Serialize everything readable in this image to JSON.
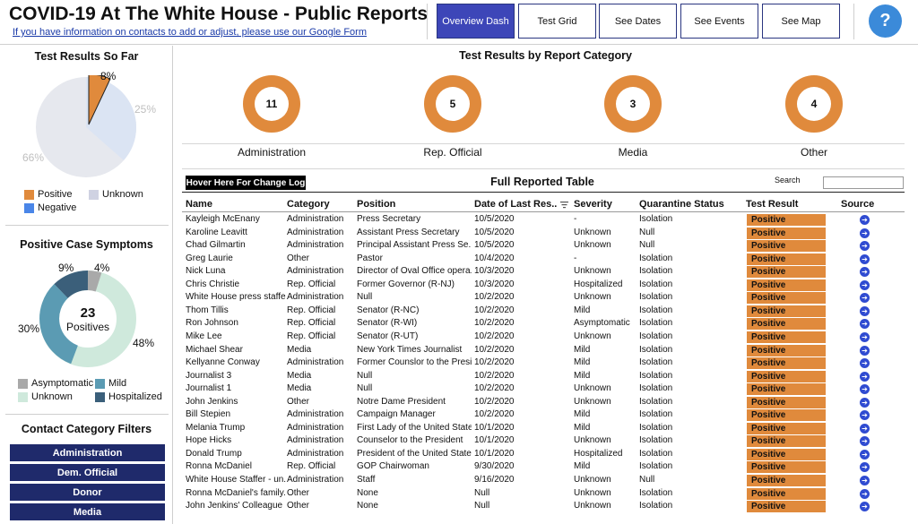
{
  "header": {
    "title": "COVID-19 At The White House - Public Reports",
    "form_link": "If you have information on contacts to add or adjust, please use our Google Form",
    "nav": [
      "Overview Dash",
      "Test Grid",
      "See Dates",
      "See Events",
      "See Map"
    ],
    "active_nav": "Overview Dash",
    "help_label": "?"
  },
  "test_results": {
    "title": "Test Results So Far",
    "labels": {
      "positive": "8%",
      "negative": "25%",
      "unknown": "66%"
    },
    "legend": {
      "positive": "Positive",
      "unknown": "Unknown",
      "negative": "Negative"
    },
    "colors": {
      "positive": "#e08a3c",
      "negative": "#dbe4f3",
      "unknown": "#e6e8ee"
    }
  },
  "symptoms": {
    "title": "Positive Case Symptoms",
    "center_value": "23",
    "center_label": "Positives",
    "labels": {
      "asymptomatic": "4%",
      "hospitalized": "9%",
      "mild": "30%",
      "unknown": "48%"
    },
    "legend": {
      "asymptomatic": "Asymptomatic",
      "mild": "Mild",
      "unknown": "Unknown",
      "hospitalized": "Hospitalized"
    },
    "colors": {
      "asymptomatic": "#a9a9a9",
      "mild": "#5b9bb3",
      "unknown": "#cfe9dc",
      "hospitalized": "#3b5f7a"
    }
  },
  "filters": {
    "title": "Contact Category Filters",
    "items": [
      "Administration",
      "Dem. Official",
      "Donor",
      "Media"
    ]
  },
  "categories": {
    "title": "Test Results by Report Category",
    "items": [
      {
        "count": "11",
        "label": "Administration"
      },
      {
        "count": "5",
        "label": "Rep. Official"
      },
      {
        "count": "3",
        "label": "Media"
      },
      {
        "count": "4",
        "label": "Other"
      }
    ]
  },
  "table": {
    "changelog": "Hover Here For Change Log",
    "title": "Full Reported Table",
    "search_label": "Search",
    "search_value": "",
    "columns": [
      "Name",
      "Category",
      "Position",
      "Date of Last Res..",
      "Severity",
      "Quarantine Status",
      "Test Result",
      "Source"
    ],
    "rows": [
      [
        "Kayleigh McEnany",
        "Administration",
        "Press Secretary",
        "10/5/2020",
        "-",
        "Isolation",
        "Positive"
      ],
      [
        "Karoline Leavitt",
        "Administration",
        "Assistant Press Secretary",
        "10/5/2020",
        "Unknown",
        "Null",
        "Positive"
      ],
      [
        "Chad Gilmartin",
        "Administration",
        "Principal Assistant Press Se..",
        "10/5/2020",
        "Unknown",
        "Null",
        "Positive"
      ],
      [
        "Greg Laurie",
        "Other",
        "Pastor",
        "10/4/2020",
        "-",
        "Isolation",
        "Positive"
      ],
      [
        "Nick Luna",
        "Administration",
        "Director of Oval Office opera..",
        "10/3/2020",
        "Unknown",
        "Isolation",
        "Positive"
      ],
      [
        "Chris Christie",
        "Rep. Official",
        "Former Governor (R-NJ)",
        "10/3/2020",
        "Hospitalized",
        "Isolation",
        "Positive"
      ],
      [
        "White House press staffer",
        "Administration",
        "Null",
        "10/2/2020",
        "Unknown",
        "Isolation",
        "Positive"
      ],
      [
        "Thom Tillis",
        "Rep. Official",
        "Senator (R-NC)",
        "10/2/2020",
        "Mild",
        "Isolation",
        "Positive"
      ],
      [
        "Ron Johnson",
        "Rep. Official",
        "Senator (R-WI)",
        "10/2/2020",
        "Asymptomatic",
        "Isolation",
        "Positive"
      ],
      [
        "Mike Lee",
        "Rep. Official",
        "Senator (R-UT)",
        "10/2/2020",
        "Unknown",
        "Isolation",
        "Positive"
      ],
      [
        "Michael Shear",
        "Media",
        "New York Times Journalist",
        "10/2/2020",
        "Mild",
        "Isolation",
        "Positive"
      ],
      [
        "Kellyanne Conway",
        "Administration",
        "Former Counslor to the Presi..",
        "10/2/2020",
        "Mild",
        "Isolation",
        "Positive"
      ],
      [
        "Journalist 3",
        "Media",
        "Null",
        "10/2/2020",
        "Mild",
        "Isolation",
        "Positive"
      ],
      [
        "Journalist 1",
        "Media",
        "Null",
        "10/2/2020",
        "Unknown",
        "Isolation",
        "Positive"
      ],
      [
        "John Jenkins",
        "Other",
        "Notre Dame President",
        "10/2/2020",
        "Unknown",
        "Isolation",
        "Positive"
      ],
      [
        "Bill Stepien",
        "Administration",
        "Campaign Manager",
        "10/2/2020",
        "Mild",
        "Isolation",
        "Positive"
      ],
      [
        "Melania Trump",
        "Administration",
        "First Lady of the United States",
        "10/1/2020",
        "Mild",
        "Isolation",
        "Positive"
      ],
      [
        "Hope Hicks",
        "Administration",
        "Counselor to the President",
        "10/1/2020",
        "Unknown",
        "Isolation",
        "Positive"
      ],
      [
        "Donald Trump",
        "Administration",
        "President of the United States",
        "10/1/2020",
        "Hospitalized",
        "Isolation",
        "Positive"
      ],
      [
        "Ronna McDaniel",
        "Rep. Official",
        "GOP Chairwoman",
        "9/30/2020",
        "Mild",
        "Isolation",
        "Positive"
      ],
      [
        "White House Staffer - un..",
        "Administration",
        "Staff",
        "9/16/2020",
        "Unknown",
        "Null",
        "Positive"
      ],
      [
        "Ronna McDaniel's family..",
        "Other",
        "None",
        "Null",
        "Unknown",
        "Isolation",
        "Positive"
      ],
      [
        "John Jenkins' Colleague",
        "Other",
        "None",
        "Null",
        "Unknown",
        "Isolation",
        "Positive"
      ]
    ]
  }
}
